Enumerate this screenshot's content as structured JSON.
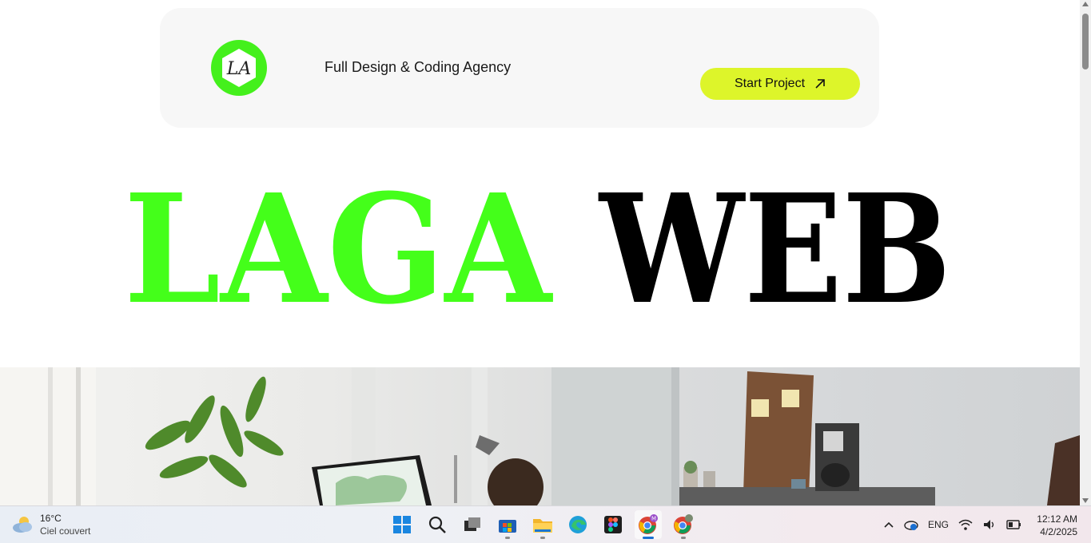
{
  "header": {
    "logo_text": "LA",
    "tagline": "Full Design & Coding Agency",
    "cta_label": "Start Project",
    "cta_icon": "arrow-up-right-icon",
    "colors": {
      "card": "#f7f7f7",
      "logo_green": "#44f01c",
      "cta_bg": "#ddf52a"
    }
  },
  "hero": {
    "word_1": "LAGA",
    "word_2": "WEB",
    "colors": {
      "word_1": "#44ff1a",
      "word_2": "#000000"
    }
  },
  "photo": {
    "description_icon": "office-workspace-photo"
  },
  "taskbar": {
    "weather": {
      "temp": "16°C",
      "desc": "Ciel couvert",
      "icon": "cloudy-weather-icon"
    },
    "apps": [
      {
        "name": "start",
        "icon": "windows-start-icon"
      },
      {
        "name": "search",
        "icon": "search-icon"
      },
      {
        "name": "task-view",
        "icon": "task-view-icon"
      },
      {
        "name": "store",
        "icon": "microsoft-store-icon"
      },
      {
        "name": "file-explorer",
        "icon": "folder-icon"
      },
      {
        "name": "edge",
        "icon": "edge-browser-icon"
      },
      {
        "name": "figma",
        "icon": "figma-icon"
      },
      {
        "name": "chrome-profile-m",
        "icon": "chrome-icon"
      },
      {
        "name": "chrome-profile-2",
        "icon": "chrome-icon"
      }
    ],
    "tray": {
      "lang": "ENG"
    },
    "clock": {
      "time": "12:12 AM",
      "date": "4/2/2025"
    }
  }
}
